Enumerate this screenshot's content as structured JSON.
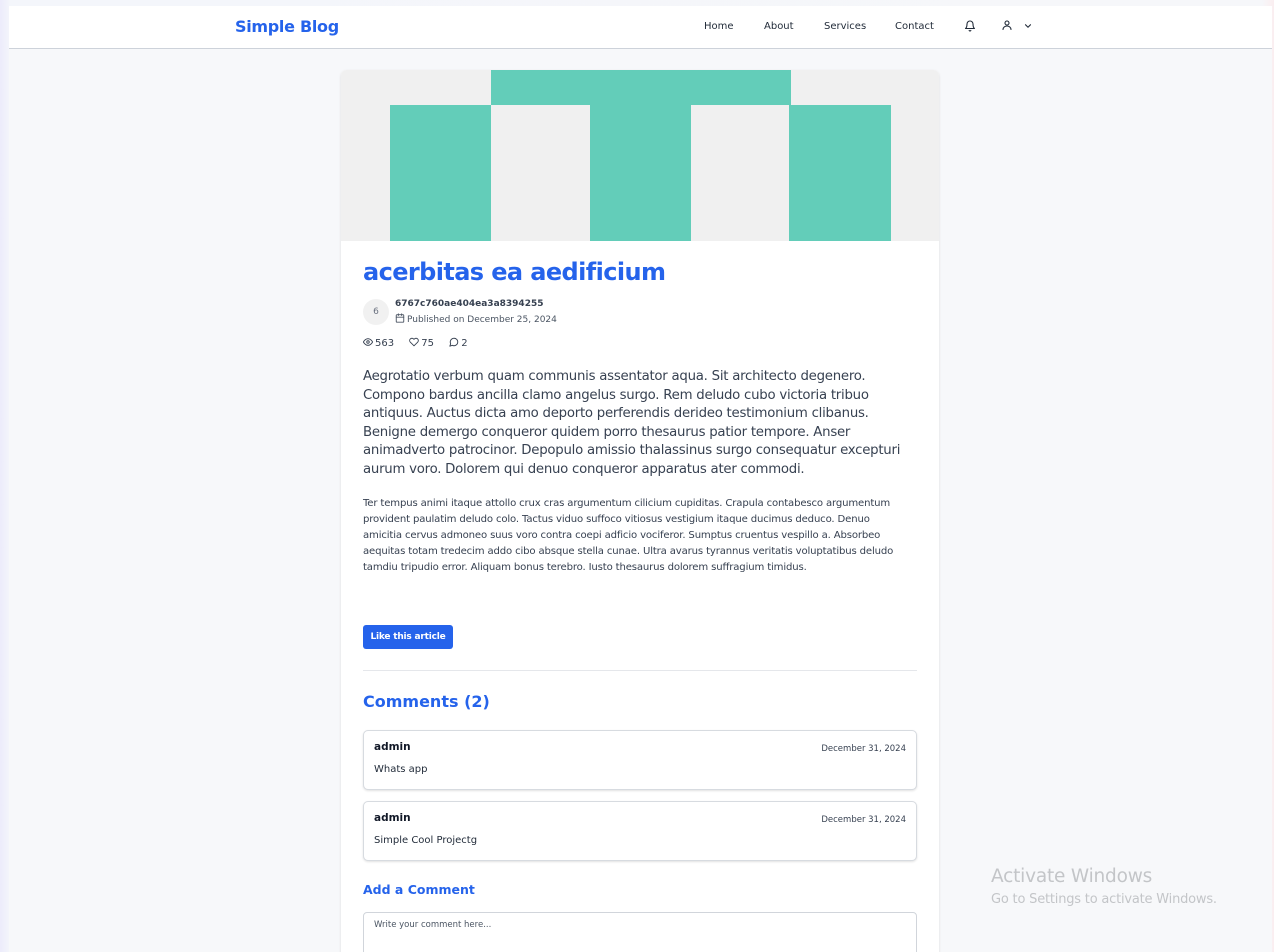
{
  "navbar": {
    "brand": "Simple Blog",
    "links": [
      "Home",
      "About",
      "Services",
      "Contact"
    ],
    "icons": [
      "bell-icon",
      "user-icon",
      "chevron-down-icon"
    ]
  },
  "article": {
    "title": "acerbitas ea aedificium",
    "avatar_initial": "6",
    "author_id": "6767c760ae404ea3a8394255",
    "published": "Published on December 25, 2024",
    "stats": {
      "views": "563",
      "likes": "75",
      "comments": "2"
    },
    "lead": "Aegrotatio verbum quam communis assentator aqua. Sit architecto degenero. Compono bardus ancilla clamo angelus surgo. Rem deludo cubo victoria tribuo antiquus. Auctus dicta amo deporto perferendis derideo testimonium clibanus. Benigne demergo conqueror quidem porro thesaurus patior tempore. Anser animadverto patrocinor. Depopulo amissio thalassinus surgo consequatur excepturi aurum voro. Dolorem qui denuo conqueror apparatus ater commodi.",
    "body": "Ter tempus animi itaque attollo crux cras argumentum cilicium cupiditas. Crapula contabesco argumentum provident paulatim deludo colo. Tactus viduo suffoco vitiosus vestigium itaque ducimus deduco. Denuo amicitia cervus admoneo suus voro contra coepi adficio vociferor. Sumptus cruentus vespillo a. Absorbeo aequitas totam tredecim addo cibo absque stella cunae. Ultra avarus tyrannus veritatis voluptatibus deludo tamdiu tripudio error. Aliquam bonus terebro. Iusto thesaurus dolorem suffragium timidus.",
    "like_button": "Like this article"
  },
  "comments": {
    "heading": "Comments (2)",
    "items": [
      {
        "author": "admin",
        "date": "December 31, 2024",
        "text": "Whats app"
      },
      {
        "author": "admin",
        "date": "December 31, 2024",
        "text": "Simple Cool Projectg"
      }
    ],
    "add_heading": "Add a Comment",
    "placeholder": "Write your comment here..."
  },
  "watermark": {
    "title": "Activate Windows",
    "subtitle": "Go to Settings to activate Windows."
  },
  "colors": {
    "accent": "#2563eb",
    "hero_pattern": "#63cdb9",
    "hero_background": "#f0f0f0"
  }
}
